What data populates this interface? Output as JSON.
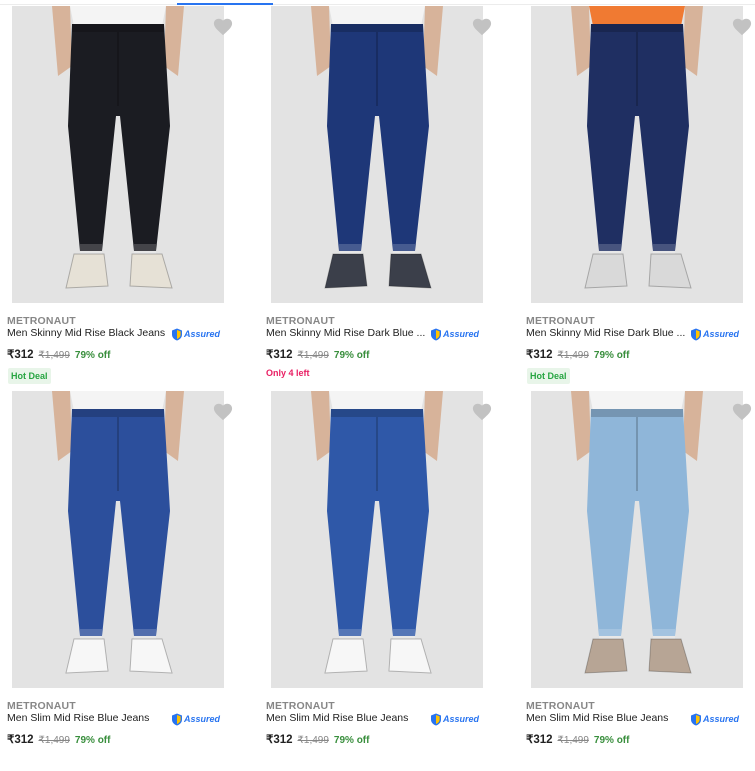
{
  "colors": {
    "accent": "#2874f0",
    "discount": "#388e3c",
    "hot_deal_bg": "#e8f5e9",
    "hot_deal_fg": "#26a541",
    "low_stock": "#e91e63",
    "heart": "#c2c2c2"
  },
  "products": [
    {
      "brand": "METRONAUT",
      "title": "Men Skinny Mid Rise Black Jeans",
      "assured": "Assured",
      "price": "₹312",
      "mrp": "₹1,499",
      "discount": "79% off",
      "tag": "Hot Deal",
      "tag_type": "deal",
      "icon": "heart-icon",
      "jeans_color": "#1b1c22",
      "top_color": "#f4f4f4",
      "shoe_color": "#e6e1d6"
    },
    {
      "brand": "METRONAUT",
      "title": "Men Skinny Mid Rise Dark Blue ...",
      "assured": "Assured",
      "price": "₹312",
      "mrp": "₹1,499",
      "discount": "79% off",
      "tag": "Only 4 left",
      "tag_type": "stock",
      "icon": "heart-icon",
      "jeans_color": "#1e3778",
      "top_color": "#f4f4f4",
      "shoe_color": "#3b3f4a"
    },
    {
      "brand": "METRONAUT",
      "title": "Men Skinny Mid Rise Dark Blue ...",
      "assured": "Assured",
      "price": "₹312",
      "mrp": "₹1,499",
      "discount": "79% off",
      "tag": "Hot Deal",
      "tag_type": "deal",
      "icon": "heart-icon",
      "jeans_color": "#1f2f62",
      "top_color": "#f07a32",
      "shoe_color": "#d9d9d9"
    },
    {
      "brand": "METRONAUT",
      "title": "Men Slim Mid Rise Blue Jeans",
      "assured": "Assured",
      "price": "₹312",
      "mrp": "₹1,499",
      "discount": "79% off",
      "tag": "",
      "tag_type": "none",
      "icon": "heart-icon",
      "jeans_color": "#2c4f9c",
      "top_color": "#f4f4f4",
      "shoe_color": "#f7f7f7"
    },
    {
      "brand": "METRONAUT",
      "title": "Men Slim Mid Rise Blue Jeans",
      "assured": "Assured",
      "price": "₹312",
      "mrp": "₹1,499",
      "discount": "79% off",
      "tag": "",
      "tag_type": "none",
      "icon": "heart-icon",
      "jeans_color": "#2f58a8",
      "top_color": "#f4f4f4",
      "shoe_color": "#f7f7f7"
    },
    {
      "brand": "METRONAUT",
      "title": "Men Slim Mid Rise Blue Jeans",
      "assured": "Assured",
      "price": "₹312",
      "mrp": "₹1,499",
      "discount": "79% off",
      "tag": "",
      "tag_type": "none",
      "icon": "heart-icon",
      "jeans_color": "#8fb6d9",
      "top_color": "#f4f4f4",
      "shoe_color": "#b7a595"
    }
  ]
}
